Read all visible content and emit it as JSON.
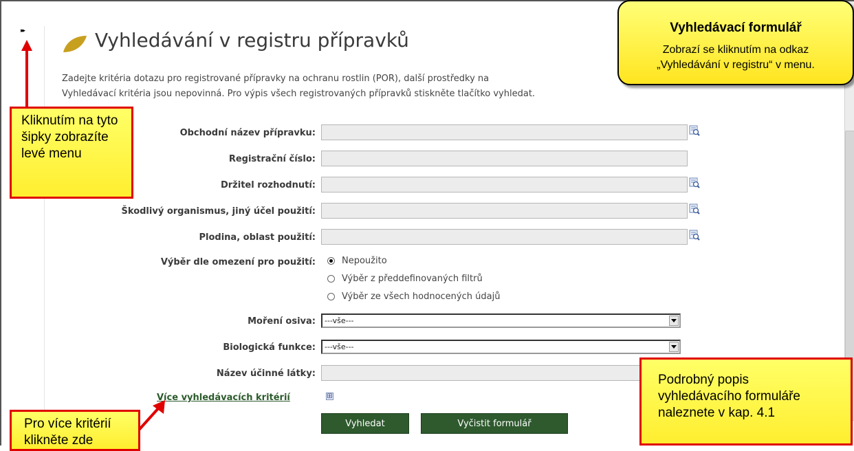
{
  "header": {
    "expand_arrows": "▸▸",
    "title": "Vyhledávání v registru přípravků",
    "intro_line1": "Zadejte kritéria dotazu pro registrované přípravky na ochranu rostlin (POR), další prostředky na",
    "intro_line2": "Vyhledávací kritéria jsou nepovinná. Pro výpis všech registrovaných přípravků stiskněte tlačítko vyhledat."
  },
  "form": {
    "fields": [
      {
        "label": "Obchodní název přípravku:",
        "value": ""
      },
      {
        "label": "Registrační číslo:",
        "value": ""
      },
      {
        "label": "Držitel rozhodnutí:",
        "value": ""
      },
      {
        "label": "Škodlivý organismus, jiný účel použití:",
        "value": ""
      },
      {
        "label": "Plodina, oblast použití:",
        "value": ""
      }
    ],
    "restriction_label": "Výběr dle omezení pro použití:",
    "radio_options": [
      {
        "label": "Nepoužito",
        "checked": true
      },
      {
        "label": "Výběr z předdefinovaných filtrů",
        "checked": false
      },
      {
        "label": "Výběr ze všech hodnocených údajů",
        "checked": false
      }
    ],
    "seed_label": "Moření osiva:",
    "seed_value": "---vše---",
    "bio_label": "Biologická funkce:",
    "bio_value": "---vše---",
    "active_label": "Název účinné látky:",
    "active_value": "",
    "more_criteria_link": "Více vyhledávacích kritérií",
    "plus_icon": "⊞",
    "search_button": "Vyhledat",
    "clear_button": "Vyčistit formulář"
  },
  "callouts": {
    "top_title": "Vyhledávací formulář",
    "top_line1": "Zobrazí se kliknutím na odkaz",
    "top_line2": "„Vyhledávání v registru“ v menu.",
    "left_menu": "Kliknutím na tyto šipky zobrazíte levé menu",
    "more_criteria": "Pro více kritérií klikněte zde",
    "detail": "Podrobný popis vyhledávacího formuláře naleznete v kap. 4.1"
  },
  "colors": {
    "accent_green": "#2e5a2e",
    "callout_yellow": "#ffee30",
    "callout_red": "#e00000",
    "leaf": "#c8a020"
  }
}
